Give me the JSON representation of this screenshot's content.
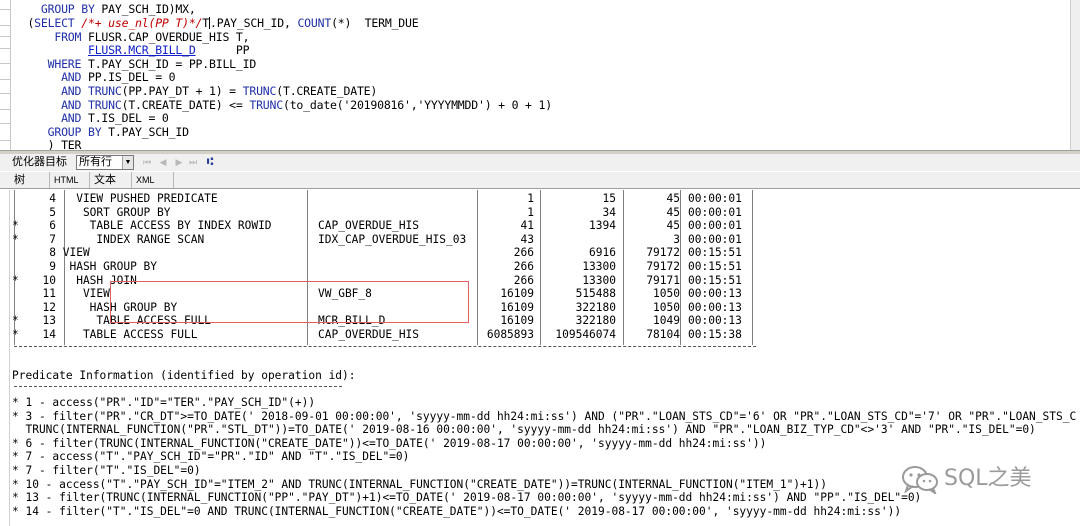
{
  "editor": {
    "lines": [
      [
        {
          "t": "    "
        },
        {
          "t": "GROUP BY",
          "c": "kw"
        },
        {
          "t": " PAY_SCH_ID)MX,"
        }
      ],
      [
        {
          "t": "  ("
        },
        {
          "t": "SELECT",
          "c": "kw"
        },
        {
          "t": " "
        },
        {
          "t": "/*+ use_nl(PP T)*/",
          "c": "cm"
        },
        {
          "t": "T"
        },
        {
          "caret": true
        },
        {
          "t": ".PAY_SCH_ID, "
        },
        {
          "t": "COUNT",
          "c": "fn"
        },
        {
          "t": "(*)  TERM_DUE"
        }
      ],
      [
        {
          "t": "      "
        },
        {
          "t": "FROM",
          "c": "kw"
        },
        {
          "t": " FLUSR.CAP_OVERDUE_HIS T,"
        }
      ],
      [
        {
          "t": "           "
        },
        {
          "t": "FLUSR.MCR_BILL_D",
          "c": "lnk"
        },
        {
          "t": "      PP"
        }
      ],
      [
        {
          "t": "     "
        },
        {
          "t": "WHERE",
          "c": "kw"
        },
        {
          "t": " T.PAY_SCH_ID = PP.BILL_ID"
        }
      ],
      [
        {
          "t": "       "
        },
        {
          "t": "AND",
          "c": "kw"
        },
        {
          "t": " PP.IS_DEL = 0"
        }
      ],
      [
        {
          "t": "       "
        },
        {
          "t": "AND",
          "c": "kw"
        },
        {
          "t": " "
        },
        {
          "t": "TRUNC",
          "c": "fn"
        },
        {
          "t": "(PP.PAY_DT + 1) = "
        },
        {
          "t": "TRUNC",
          "c": "fn"
        },
        {
          "t": "(T.CREATE_DATE)"
        }
      ],
      [
        {
          "t": "       "
        },
        {
          "t": "AND",
          "c": "kw"
        },
        {
          "t": " "
        },
        {
          "t": "TRUNC",
          "c": "fn"
        },
        {
          "t": "(T.CREATE_DATE) <= "
        },
        {
          "t": "TRUNC",
          "c": "fn"
        },
        {
          "t": "(to_date('20190816','YYYYMMDD') + 0 + 1)"
        }
      ],
      [
        {
          "t": "       "
        },
        {
          "t": "AND",
          "c": "kw"
        },
        {
          "t": " T.IS_DEL = 0"
        }
      ],
      [
        {
          "t": "     "
        },
        {
          "t": "GROUP BY",
          "c": "kw"
        },
        {
          "t": " T.PAY_SCH_ID"
        }
      ],
      [
        {
          "t": "     ) TER"
        }
      ]
    ]
  },
  "toolbar": {
    "optimizer_label": "优化器目标",
    "optimizer_value": "所有行",
    "nav_first_icon": "⏮",
    "nav_prev_icon": "◀",
    "nav_next_icon": "▶",
    "nav_last_icon": "⏭",
    "tree_icon": "⑆"
  },
  "tabs": [
    {
      "label": "树"
    },
    {
      "label": "HTML"
    },
    {
      "label": "文本"
    },
    {
      "label": "XML"
    }
  ],
  "plan": {
    "rows": [
      {
        "mark": "",
        "id": "4",
        "op": "   VIEW PUSHED PREDICATE",
        "name": "",
        "rows": "1",
        "bytes": "15",
        "cost": "45",
        "time": "00:00:01"
      },
      {
        "mark": "",
        "id": "5",
        "op": "    SORT GROUP BY",
        "name": "",
        "rows": "1",
        "bytes": "34",
        "cost": "45",
        "time": "00:00:01"
      },
      {
        "mark": "*",
        "id": "6",
        "op": "     TABLE ACCESS BY INDEX ROWID",
        "name": "CAP_OVERDUE_HIS",
        "rows": "41",
        "bytes": "1394",
        "cost": "45",
        "time": "00:00:01"
      },
      {
        "mark": "*",
        "id": "7",
        "op": "      INDEX RANGE SCAN",
        "name": "IDX_CAP_OVERDUE_HIS_03",
        "rows": "43",
        "bytes": "",
        "cost": "3",
        "time": "00:00:01"
      },
      {
        "mark": "",
        "id": "8",
        "op": " VIEW",
        "name": "",
        "rows": "266",
        "bytes": "6916",
        "cost": "79172",
        "time": "00:15:51"
      },
      {
        "mark": "",
        "id": "9",
        "op": "  HASH GROUP BY",
        "name": "",
        "rows": "266",
        "bytes": "13300",
        "cost": "79172",
        "time": "00:15:51"
      },
      {
        "mark": "*",
        "id": "10",
        "op": "   HASH JOIN",
        "name": "",
        "rows": "266",
        "bytes": "13300",
        "cost": "79171",
        "time": "00:15:51"
      },
      {
        "mark": "",
        "id": "11",
        "op": "    VIEW",
        "name": "VW_GBF_8",
        "rows": "16109",
        "bytes": "515488",
        "cost": "1050",
        "time": "00:00:13"
      },
      {
        "mark": "",
        "id": "12",
        "op": "     HASH GROUP BY",
        "name": "",
        "rows": "16109",
        "bytes": "322180",
        "cost": "1050",
        "time": "00:00:13"
      },
      {
        "mark": "*",
        "id": "13",
        "op": "      TABLE ACCESS FULL",
        "name": "MCR_BILL_D",
        "rows": "16109",
        "bytes": "322180",
        "cost": "1049",
        "time": "00:00:13"
      },
      {
        "mark": "*",
        "id": "14",
        "op": "    TABLE ACCESS FULL",
        "name": "CAP_OVERDUE_HIS",
        "rows": "6085893",
        "bytes": "109546074",
        "cost": "78104",
        "time": "00:15:38"
      }
    ],
    "predicate_title": "Predicate Information (identified by operation id):",
    "predicates": [
      "* 1 - access(\"PR\".\"ID\"=\"TER\".\"PAY_SCH_ID\"(+))",
      "* 3 - filter(\"PR\".\"CR_DT\">=TO_DATE(' 2018-09-01 00:00:00', 'syyyy-mm-dd hh24:mi:ss') AND (\"PR\".\"LOAN_STS_CD\"='6' OR \"PR\".\"LOAN_STS_CD\"='7' OR \"PR\".\"LOAN_STS_C",
      "  TRUNC(INTERNAL_FUNCTION(\"PR\".\"STL_DT\"))=TO_DATE(' 2019-08-16 00:00:00', 'syyyy-mm-dd hh24:mi:ss') AND \"PR\".\"LOAN_BIZ_TYP_CD\"<>'3' AND \"PR\".\"IS_DEL\"=0)",
      "* 6 - filter(TRUNC(INTERNAL_FUNCTION(\"CREATE_DATE\"))<=TO_DATE(' 2019-08-17 00:00:00', 'syyyy-mm-dd hh24:mi:ss'))",
      "* 7 - access(\"T\".\"PAY_SCH_ID\"=\"PR\".\"ID\" AND \"T\".\"IS_DEL\"=0)",
      "* 7 - filter(\"T\".\"IS_DEL\"=0)",
      "* 10 - access(\"T\".\"PAY_SCH_ID\"=\"ITEM_2\" AND TRUNC(INTERNAL_FUNCTION(\"CREATE_DATE\"))=TRUNC(INTERNAL_FUNCTION(\"ITEM_1\")+1))",
      "* 13 - filter(TRUNC(INTERNAL_FUNCTION(\"PP\".\"PAY_DT\")+1)<=TO_DATE(' 2019-08-17 00:00:00', 'syyyy-mm-dd hh24:mi:ss') AND \"PP\".\"IS_DEL\"=0)",
      "* 14 - filter(\"T\".\"IS_DEL\"=0 AND TRUNC(INTERNAL_FUNCTION(\"CREATE_DATE\"))<=TO_DATE(' 2019-08-17 00:00:00', 'syyyy-mm-dd hh24:mi:ss'))"
    ]
  },
  "watermark": {
    "text": "SQL之美",
    "icon": "wechat-icon",
    "color": "#9a9a9a"
  },
  "colors": {
    "keyword": "#2030a8",
    "comment": "#c00000",
    "highlight_box": "#e06060"
  }
}
